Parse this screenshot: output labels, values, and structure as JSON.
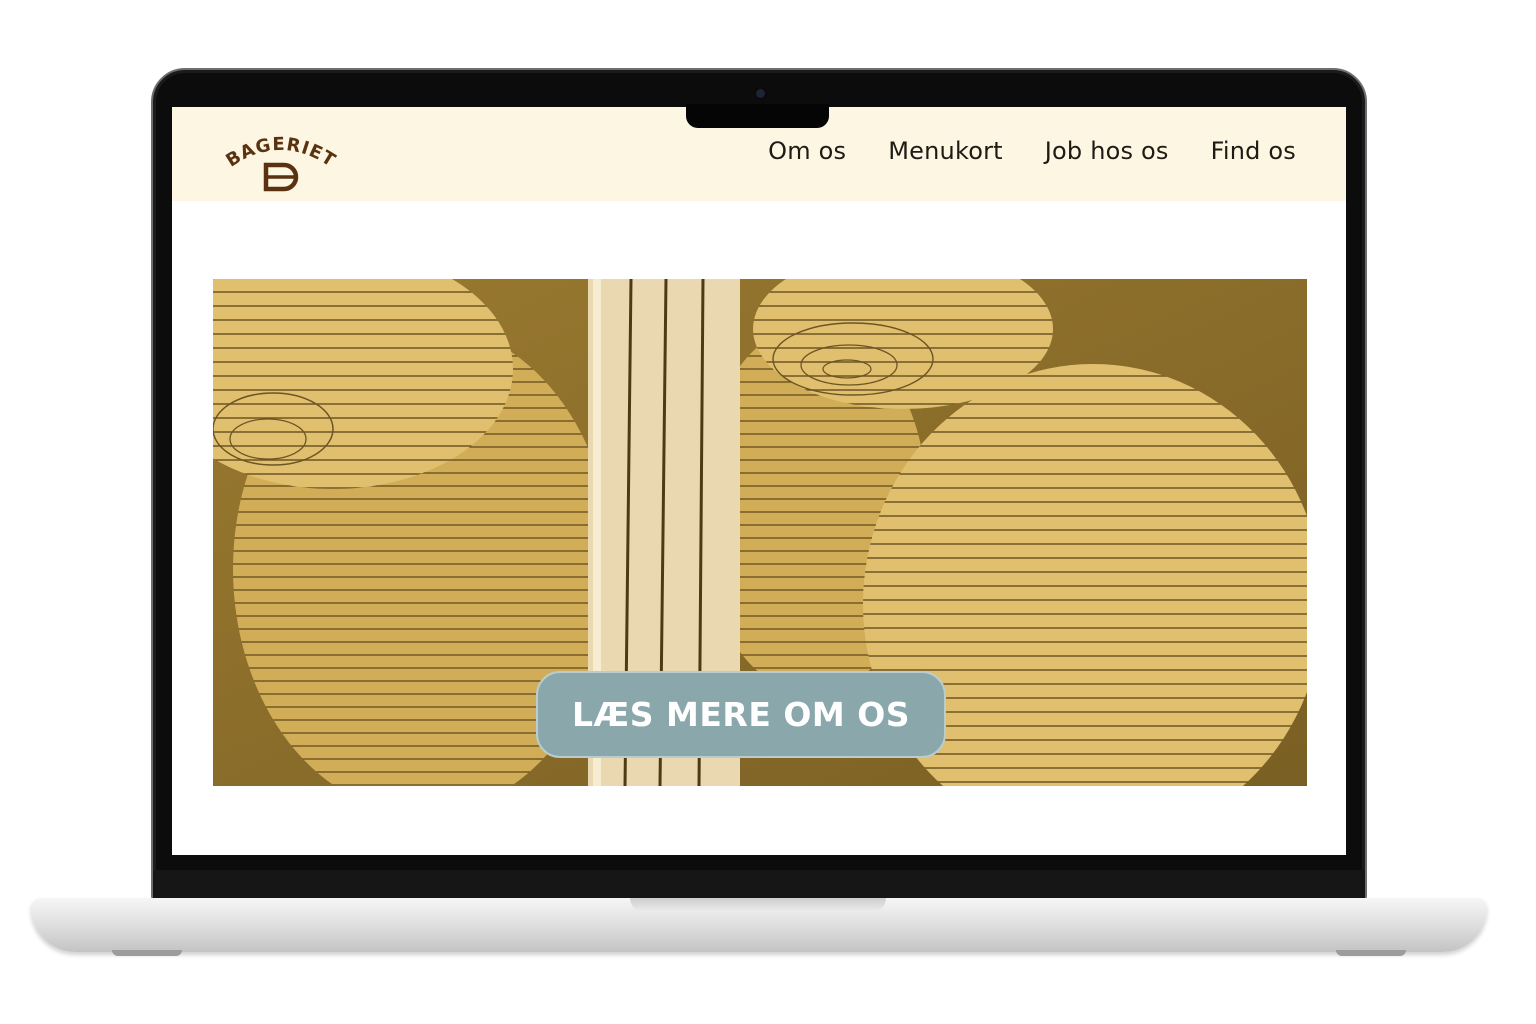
{
  "site": {
    "brand": "BAGERIET"
  },
  "nav": {
    "items": [
      {
        "label": "Om os"
      },
      {
        "label": "Menukort"
      },
      {
        "label": "Job hos os"
      },
      {
        "label": "Find os"
      }
    ]
  },
  "hero": {
    "cta_label": "LÆS MERE OM OS"
  },
  "colors": {
    "header_bg": "#fdf6e3",
    "brand_brown": "#5a3210",
    "hero_gold": "#c9a349",
    "cta_bg": "#8aa8ac"
  }
}
